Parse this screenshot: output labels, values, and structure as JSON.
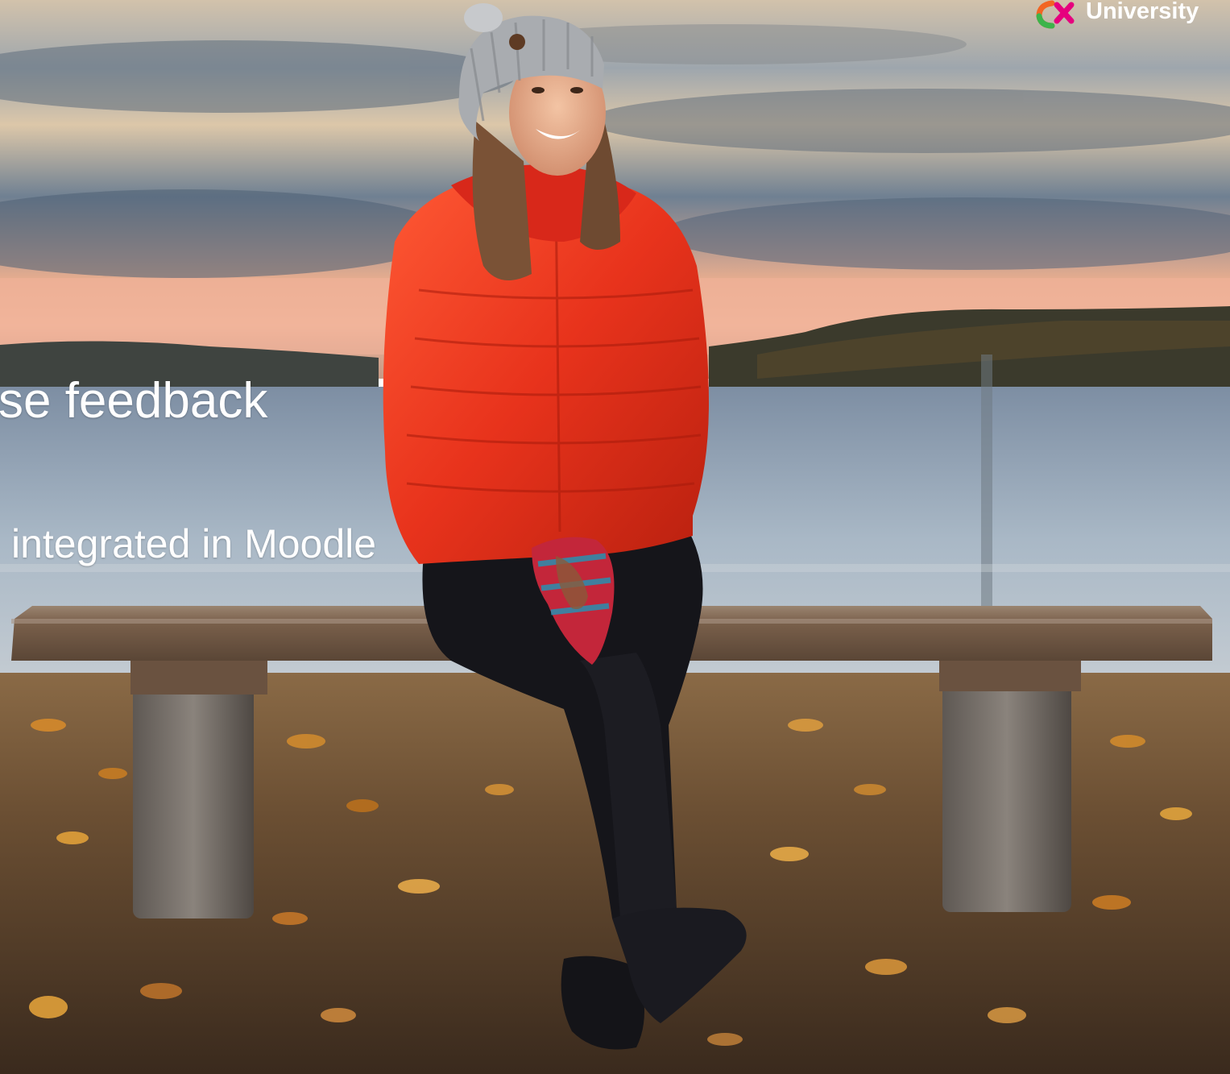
{
  "slide": {
    "title": "se feedback",
    "subtitle": "integrated in Moodle"
  },
  "logo": {
    "text": "University",
    "icon": "university-logo-mark",
    "colors": [
      "#f26522",
      "#3cb44a",
      "#e6007e"
    ]
  },
  "photo": {
    "subject": "person-on-bench-by-lake",
    "colors": {
      "jacket": "#e8331c",
      "sky": "#6f7d8c",
      "water": "#9fb0c2",
      "ground": "#5a432c"
    }
  }
}
